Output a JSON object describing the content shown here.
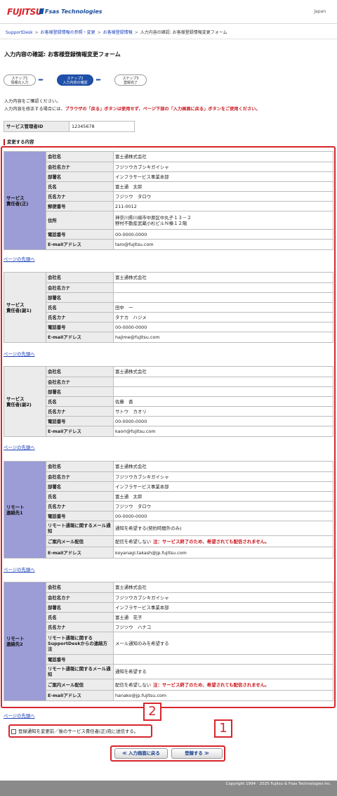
{
  "header": {
    "logo_text": "FUJITSU",
    "brand_text": "Fsas Technologies",
    "language": "Japan"
  },
  "breadcrumb": [
    "SupportDesk",
    "お客様登録情報の参照・変更",
    "お客様登録情報",
    "入力内容の確認: お客様登録情報変更フォーム"
  ],
  "page_title": "入力内容の確認: お客様登録情報変更フォーム",
  "steps": [
    {
      "line1": "ステップ1",
      "line2": "情報の入力"
    },
    {
      "line1": "ステップ2",
      "line2": "入力内容の確認"
    },
    {
      "line1": "ステップ3",
      "line2": "登録完了"
    }
  ],
  "intro": {
    "line1": "入力内容をご確認ください。",
    "line2_prefix": "入力内容を修正する場合には、",
    "line2_warn": "ブラウザの「戻る」ボタンは使用せず、ページ下部の「入力画面に戻る」ボタンをご使用ください。"
  },
  "service_admin": {
    "label": "サービス管理者ID",
    "value": "12345678"
  },
  "section_label": "変更する内容",
  "top_link": "ページの先頭へ",
  "groups": [
    {
      "title": "サービス\n責任者(正)",
      "rows": [
        {
          "key": "会社名",
          "value": "富士通株式会社"
        },
        {
          "key": "会社名カナ",
          "value": "フジツウカブシキガイシャ"
        },
        {
          "key": "部署名",
          "value": "インフラサービス事業本部"
        },
        {
          "key": "氏名",
          "value": "富士通　太郎"
        },
        {
          "key": "氏名カナ",
          "value": "フジツウ　タロウ"
        },
        {
          "key": "郵便番号",
          "value": "211-0012"
        },
        {
          "key": "住所",
          "value": "神奈川県川崎市中原区中丸子１３－２\n野村不動産武蔵小杉ビルＮ棟１２階"
        },
        {
          "key": "電話番号",
          "value": "00-0000-0000"
        },
        {
          "key": "E-mailアドレス",
          "value": "taro@fujitsu.com"
        }
      ]
    },
    {
      "title": "サービス\n責任者(副1)",
      "rows": [
        {
          "key": "会社名",
          "value": "富士通株式会社"
        },
        {
          "key": "会社名カナ",
          "value": ""
        },
        {
          "key": "部署名",
          "value": ""
        },
        {
          "key": "氏名",
          "value": "田中　一"
        },
        {
          "key": "氏名カナ",
          "value": "タナカ　ハジメ"
        },
        {
          "key": "電話番号",
          "value": "00-0000-0000"
        },
        {
          "key": "E-mailアドレス",
          "value": "hajime@fujitsu.com"
        }
      ]
    },
    {
      "title": "サービス\n責任者(副2)",
      "rows": [
        {
          "key": "会社名",
          "value": "富士通株式会社"
        },
        {
          "key": "会社名カナ",
          "value": ""
        },
        {
          "key": "部署名",
          "value": ""
        },
        {
          "key": "氏名",
          "value": "佐藤　香"
        },
        {
          "key": "氏名カナ",
          "value": "サトウ　カオリ"
        },
        {
          "key": "電話番号",
          "value": "00-0000-0000"
        },
        {
          "key": "E-mailアドレス",
          "value": "kaori@fujitsu.com"
        }
      ]
    },
    {
      "title": "リモート\n連絡先1",
      "rows": [
        {
          "key": "会社名",
          "value": "富士通株式会社"
        },
        {
          "key": "会社名カナ",
          "value": "フジツウカブシキガイシャ"
        },
        {
          "key": "部署名",
          "value": "インフラサービス事業本部"
        },
        {
          "key": "氏名",
          "value": "富士通　太郎"
        },
        {
          "key": "氏名カナ",
          "value": "フジツウ　タロウ"
        },
        {
          "key": "電話番号",
          "value": "00-0000-0000"
        },
        {
          "key": "リモート通報に関するメール通知",
          "value": "通知を希望する(契約時間外のみ)"
        },
        {
          "key": "ご案内メール配信",
          "value": "配信を希望しない",
          "note": "注：サービス終了のため、希望されても配信されません。"
        },
        {
          "key": "E-mailアドレス",
          "value": "koyanagi.takash@jp.fujitsu.com"
        }
      ]
    },
    {
      "title": "リモート\n連絡先2",
      "rows": [
        {
          "key": "会社名",
          "value": "富士通株式会社"
        },
        {
          "key": "会社名カナ",
          "value": "フジツウカブシキガイシャ"
        },
        {
          "key": "部署名",
          "value": "インフラサービス事業本部"
        },
        {
          "key": "氏名",
          "value": "富士通　花子"
        },
        {
          "key": "氏名カナ",
          "value": "フジツウ　ハナコ"
        },
        {
          "key": "リモート通報に関するSupportDeskからの連絡方法",
          "value": "メール通知のみを希望する"
        },
        {
          "key": "電話番号",
          "value": ""
        },
        {
          "key": "リモート通報に関するメール通知",
          "value": "通知を希望する"
        },
        {
          "key": "ご案内メール配信",
          "value": "配信を希望しない",
          "note": "注：サービス終了のため、希望されても配信されません。"
        },
        {
          "key": "E-mailアドレス",
          "value": "hanako@jp.fujitsu.com"
        }
      ]
    }
  ],
  "notify_label": "登録通知を変更前／後のサービス責任者(正)宛に送信する。",
  "buttons": {
    "back": "≪ 入力画面に戻る",
    "register": "登録する ≫"
  },
  "badges": {
    "one": "1",
    "two": "2"
  },
  "highlight_color": "#d7262d",
  "footer": "Copyright 1994 - 2025 Fujitsu & Fsas Technologies Inc."
}
